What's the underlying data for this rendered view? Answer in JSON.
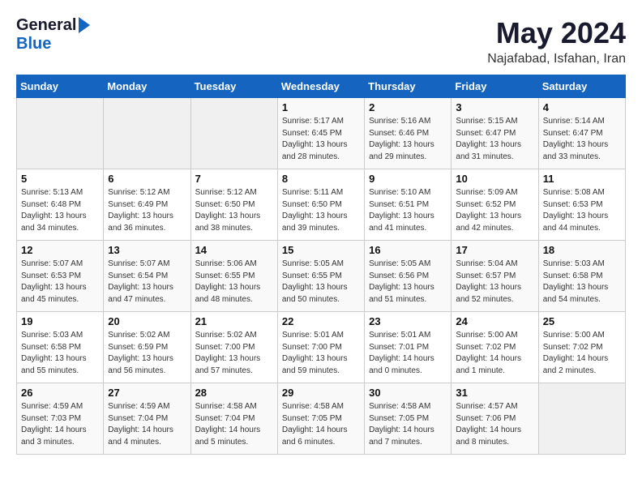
{
  "header": {
    "logo_general": "General",
    "logo_blue": "Blue",
    "month_title": "May 2024",
    "location": "Najafabad, Isfahan, Iran"
  },
  "calendar": {
    "days_of_week": [
      "Sunday",
      "Monday",
      "Tuesday",
      "Wednesday",
      "Thursday",
      "Friday",
      "Saturday"
    ],
    "weeks": [
      [
        {
          "day": "",
          "detail": ""
        },
        {
          "day": "",
          "detail": ""
        },
        {
          "day": "",
          "detail": ""
        },
        {
          "day": "1",
          "detail": "Sunrise: 5:17 AM\nSunset: 6:45 PM\nDaylight: 13 hours\nand 28 minutes."
        },
        {
          "day": "2",
          "detail": "Sunrise: 5:16 AM\nSunset: 6:46 PM\nDaylight: 13 hours\nand 29 minutes."
        },
        {
          "day": "3",
          "detail": "Sunrise: 5:15 AM\nSunset: 6:47 PM\nDaylight: 13 hours\nand 31 minutes."
        },
        {
          "day": "4",
          "detail": "Sunrise: 5:14 AM\nSunset: 6:47 PM\nDaylight: 13 hours\nand 33 minutes."
        }
      ],
      [
        {
          "day": "5",
          "detail": "Sunrise: 5:13 AM\nSunset: 6:48 PM\nDaylight: 13 hours\nand 34 minutes."
        },
        {
          "day": "6",
          "detail": "Sunrise: 5:12 AM\nSunset: 6:49 PM\nDaylight: 13 hours\nand 36 minutes."
        },
        {
          "day": "7",
          "detail": "Sunrise: 5:12 AM\nSunset: 6:50 PM\nDaylight: 13 hours\nand 38 minutes."
        },
        {
          "day": "8",
          "detail": "Sunrise: 5:11 AM\nSunset: 6:50 PM\nDaylight: 13 hours\nand 39 minutes."
        },
        {
          "day": "9",
          "detail": "Sunrise: 5:10 AM\nSunset: 6:51 PM\nDaylight: 13 hours\nand 41 minutes."
        },
        {
          "day": "10",
          "detail": "Sunrise: 5:09 AM\nSunset: 6:52 PM\nDaylight: 13 hours\nand 42 minutes."
        },
        {
          "day": "11",
          "detail": "Sunrise: 5:08 AM\nSunset: 6:53 PM\nDaylight: 13 hours\nand 44 minutes."
        }
      ],
      [
        {
          "day": "12",
          "detail": "Sunrise: 5:07 AM\nSunset: 6:53 PM\nDaylight: 13 hours\nand 45 minutes."
        },
        {
          "day": "13",
          "detail": "Sunrise: 5:07 AM\nSunset: 6:54 PM\nDaylight: 13 hours\nand 47 minutes."
        },
        {
          "day": "14",
          "detail": "Sunrise: 5:06 AM\nSunset: 6:55 PM\nDaylight: 13 hours\nand 48 minutes."
        },
        {
          "day": "15",
          "detail": "Sunrise: 5:05 AM\nSunset: 6:55 PM\nDaylight: 13 hours\nand 50 minutes."
        },
        {
          "day": "16",
          "detail": "Sunrise: 5:05 AM\nSunset: 6:56 PM\nDaylight: 13 hours\nand 51 minutes."
        },
        {
          "day": "17",
          "detail": "Sunrise: 5:04 AM\nSunset: 6:57 PM\nDaylight: 13 hours\nand 52 minutes."
        },
        {
          "day": "18",
          "detail": "Sunrise: 5:03 AM\nSunset: 6:58 PM\nDaylight: 13 hours\nand 54 minutes."
        }
      ],
      [
        {
          "day": "19",
          "detail": "Sunrise: 5:03 AM\nSunset: 6:58 PM\nDaylight: 13 hours\nand 55 minutes."
        },
        {
          "day": "20",
          "detail": "Sunrise: 5:02 AM\nSunset: 6:59 PM\nDaylight: 13 hours\nand 56 minutes."
        },
        {
          "day": "21",
          "detail": "Sunrise: 5:02 AM\nSunset: 7:00 PM\nDaylight: 13 hours\nand 57 minutes."
        },
        {
          "day": "22",
          "detail": "Sunrise: 5:01 AM\nSunset: 7:00 PM\nDaylight: 13 hours\nand 59 minutes."
        },
        {
          "day": "23",
          "detail": "Sunrise: 5:01 AM\nSunset: 7:01 PM\nDaylight: 14 hours\nand 0 minutes."
        },
        {
          "day": "24",
          "detail": "Sunrise: 5:00 AM\nSunset: 7:02 PM\nDaylight: 14 hours\nand 1 minute."
        },
        {
          "day": "25",
          "detail": "Sunrise: 5:00 AM\nSunset: 7:02 PM\nDaylight: 14 hours\nand 2 minutes."
        }
      ],
      [
        {
          "day": "26",
          "detail": "Sunrise: 4:59 AM\nSunset: 7:03 PM\nDaylight: 14 hours\nand 3 minutes."
        },
        {
          "day": "27",
          "detail": "Sunrise: 4:59 AM\nSunset: 7:04 PM\nDaylight: 14 hours\nand 4 minutes."
        },
        {
          "day": "28",
          "detail": "Sunrise: 4:58 AM\nSunset: 7:04 PM\nDaylight: 14 hours\nand 5 minutes."
        },
        {
          "day": "29",
          "detail": "Sunrise: 4:58 AM\nSunset: 7:05 PM\nDaylight: 14 hours\nand 6 minutes."
        },
        {
          "day": "30",
          "detail": "Sunrise: 4:58 AM\nSunset: 7:05 PM\nDaylight: 14 hours\nand 7 minutes."
        },
        {
          "day": "31",
          "detail": "Sunrise: 4:57 AM\nSunset: 7:06 PM\nDaylight: 14 hours\nand 8 minutes."
        },
        {
          "day": "",
          "detail": ""
        }
      ]
    ]
  }
}
